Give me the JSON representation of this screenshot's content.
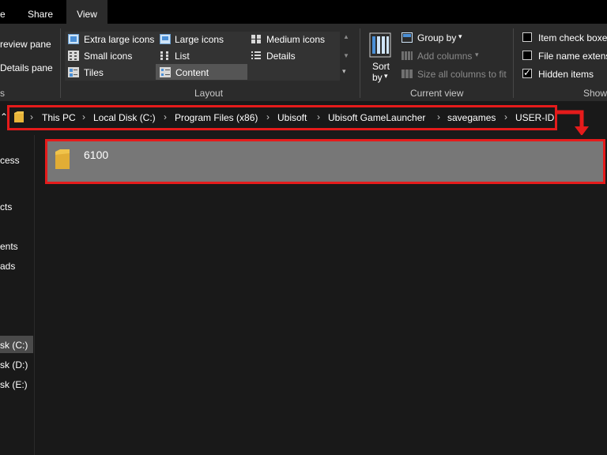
{
  "tabs": [
    {
      "label": "e"
    },
    {
      "label": "Share"
    },
    {
      "label": "View"
    }
  ],
  "ribbon": {
    "panes": {
      "preview_label": "review pane",
      "details_label": "Details pane",
      "group_label": "s"
    },
    "layout": {
      "items": [
        {
          "label": "Extra large icons",
          "icon": "extra-large-icons-icon"
        },
        {
          "label": "Large icons",
          "icon": "large-icons-icon"
        },
        {
          "label": "Medium icons",
          "icon": "medium-icons-icon"
        },
        {
          "label": "Small icons",
          "icon": "small-icons-icon"
        },
        {
          "label": "List",
          "icon": "list-icon"
        },
        {
          "label": "Details",
          "icon": "details-icon"
        },
        {
          "label": "Tiles",
          "icon": "tiles-icon"
        },
        {
          "label": "Content",
          "icon": "content-icon",
          "selected": true
        }
      ],
      "group_label": "Layout"
    },
    "current_view": {
      "sort_label_1": "Sort",
      "sort_label_2": "by",
      "group_by_label": "Group by",
      "add_columns_label": "Add columns",
      "size_columns_label": "Size all columns to fit",
      "group_label": "Current view"
    },
    "show_hide": {
      "item_check_boxes_label": "Item check boxe",
      "file_name_ext_label": "File name extens",
      "hidden_items_label": "Hidden items",
      "hidden_items_checked": true,
      "group_label": "Show"
    }
  },
  "address": {
    "crumbs": [
      "This PC",
      "Local Disk (C:)",
      "Program Files (x86)",
      "Ubisoft",
      "Ubisoft GameLauncher",
      "savegames",
      "USER-ID"
    ],
    "separator": "›"
  },
  "nav": {
    "items": [
      "cess",
      "cts",
      "ents",
      "ads",
      "sk (C:)",
      "sk (D:)",
      "sk (E:)"
    ]
  },
  "files": [
    {
      "name": "6100",
      "type": "folder"
    }
  ],
  "colors": {
    "highlight": "#e51b1b",
    "folder": "#f0c34b",
    "selected_row": "#777777"
  }
}
